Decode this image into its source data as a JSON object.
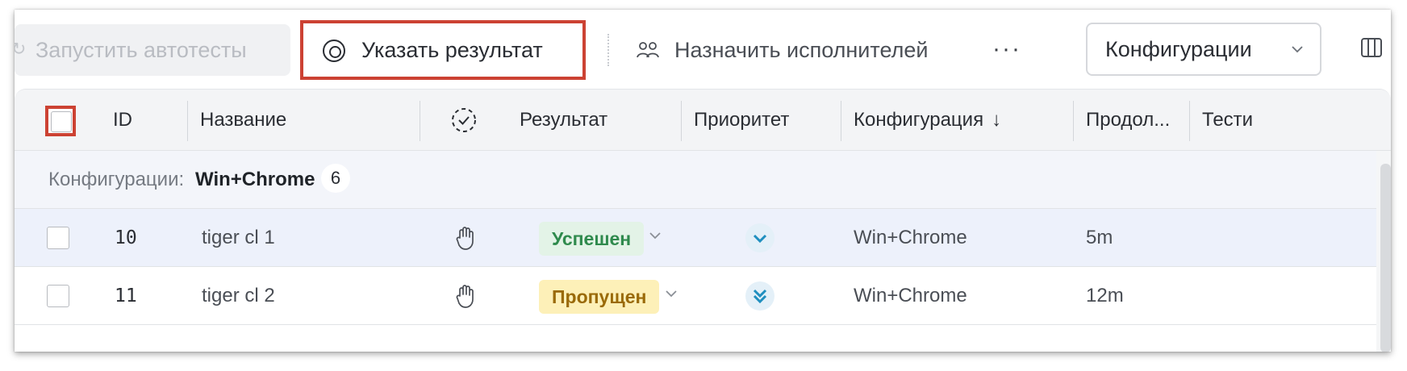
{
  "toolbar": {
    "run_autotests": "Запустить автотесты",
    "set_result": "Указать результат",
    "assign": "Назначить исполнителей",
    "more": "···",
    "configurations": "Конфигурации"
  },
  "table": {
    "columns": {
      "id": "ID",
      "name": "Название",
      "result": "Результат",
      "priority": "Приоритет",
      "configuration": "Конфигурация",
      "configuration_sort": "↓",
      "duration": "Продол...",
      "tester": "Тести"
    },
    "group": {
      "label": "Конфигурации:",
      "value": "Win+Chrome",
      "count": "6"
    },
    "rows": [
      {
        "id": "10",
        "name": "tiger cl 1",
        "result": "Успешен",
        "priority_icon": "chevron-down-icon",
        "configuration": "Win+Chrome",
        "duration": "5m"
      },
      {
        "id": "11",
        "name": "tiger cl 2",
        "result": "Пропущен",
        "priority_icon": "double-chevron-down-icon",
        "configuration": "Win+Chrome",
        "duration": "12m"
      }
    ]
  },
  "colors": {
    "highlight": "#cc4233",
    "success_bg": "#e3f3e7",
    "success_text": "#2f8a4d",
    "skipped_bg": "#fdf0b8",
    "skipped_text": "#9a6a08",
    "priority": "#1f8fbf"
  }
}
